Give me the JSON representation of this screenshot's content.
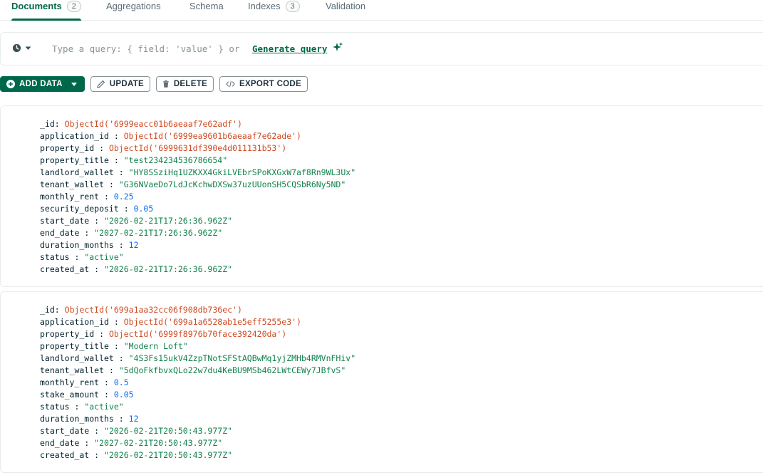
{
  "tabs": [
    {
      "label": "Documents",
      "count": "2",
      "active": true
    },
    {
      "label": "Aggregations"
    },
    {
      "label": "Schema"
    },
    {
      "label": "Indexes",
      "count": "3"
    },
    {
      "label": "Validation"
    }
  ],
  "querybar": {
    "history_icon": "clock-icon",
    "placeholder": "Type a query: { field: 'value' } or",
    "generate_label": "Generate query",
    "generate_icon": "sparkle-icon"
  },
  "toolbar": {
    "add_data": "ADD DATA",
    "update": "UPDATE",
    "delete": "DELETE",
    "export_code": "EXPORT CODE"
  },
  "colors": {
    "accent": "#00684a",
    "objectid": "#cf4a22",
    "string": "#12824d",
    "number": "#016bf8"
  },
  "documents": [
    {
      "fields": [
        {
          "key": "_id",
          "value": "ObjectId('6999eacc01b6aeaaf7e62adf')",
          "type": "oid"
        },
        {
          "key": "application_id",
          "value": "ObjectId('6999ea9601b6aeaaf7e62ade')",
          "type": "oid"
        },
        {
          "key": "property_id",
          "value": "ObjectId('6999631df390e4d011131b53')",
          "type": "oid"
        },
        {
          "key": "property_title",
          "value": "\"test234234536786654\"",
          "type": "str"
        },
        {
          "key": "landlord_wallet",
          "value": "\"HY8SSziHq1UZKXX4GkiLVEbrSPoKXGxW7af8Rn9WL3Ux\"",
          "type": "str"
        },
        {
          "key": "tenant_wallet",
          "value": "\"G36NVaeDo7LdJcKchwDXSw37uzUUonSH5CQSbR6Ny5ND\"",
          "type": "str"
        },
        {
          "key": "monthly_rent",
          "value": "0.25",
          "type": "num"
        },
        {
          "key": "security_deposit",
          "value": "0.05",
          "type": "num"
        },
        {
          "key": "start_date",
          "value": "\"2026-02-21T17:26:36.962Z\"",
          "type": "str"
        },
        {
          "key": "end_date",
          "value": "\"2027-02-21T17:26:36.962Z\"",
          "type": "str"
        },
        {
          "key": "duration_months",
          "value": "12",
          "type": "num"
        },
        {
          "key": "status",
          "value": "\"active\"",
          "type": "str"
        },
        {
          "key": "created_at",
          "value": "\"2026-02-21T17:26:36.962Z\"",
          "type": "str"
        }
      ]
    },
    {
      "fields": [
        {
          "key": "_id",
          "value": "ObjectId('699a1aa32cc06f908db736ec')",
          "type": "oid"
        },
        {
          "key": "application_id",
          "value": "ObjectId('699a1a6528ab1e5eff5255e3')",
          "type": "oid"
        },
        {
          "key": "property_id",
          "value": "ObjectId('6999f8976b70face392420da')",
          "type": "oid"
        },
        {
          "key": "property_title",
          "value": "\"Modern Loft\"",
          "type": "str"
        },
        {
          "key": "landlord_wallet",
          "value": "\"4S3Fs15ukV4ZzpTNotSFStAQBwMq1yjZMHb4RMVnFHiv\"",
          "type": "str"
        },
        {
          "key": "tenant_wallet",
          "value": "\"5dQoFkfbvxQLo22w7du4KeBU9MSb462LWtCEWy7JBfvS\"",
          "type": "str"
        },
        {
          "key": "monthly_rent",
          "value": "0.5",
          "type": "num"
        },
        {
          "key": "stake_amount",
          "value": "0.05",
          "type": "num"
        },
        {
          "key": "status",
          "value": "\"active\"",
          "type": "str"
        },
        {
          "key": "duration_months",
          "value": "12",
          "type": "num"
        },
        {
          "key": "start_date",
          "value": "\"2026-02-21T20:50:43.977Z\"",
          "type": "str"
        },
        {
          "key": "end_date",
          "value": "\"2027-02-21T20:50:43.977Z\"",
          "type": "str"
        },
        {
          "key": "created_at",
          "value": "\"2026-02-21T20:50:43.977Z\"",
          "type": "str"
        }
      ]
    }
  ]
}
